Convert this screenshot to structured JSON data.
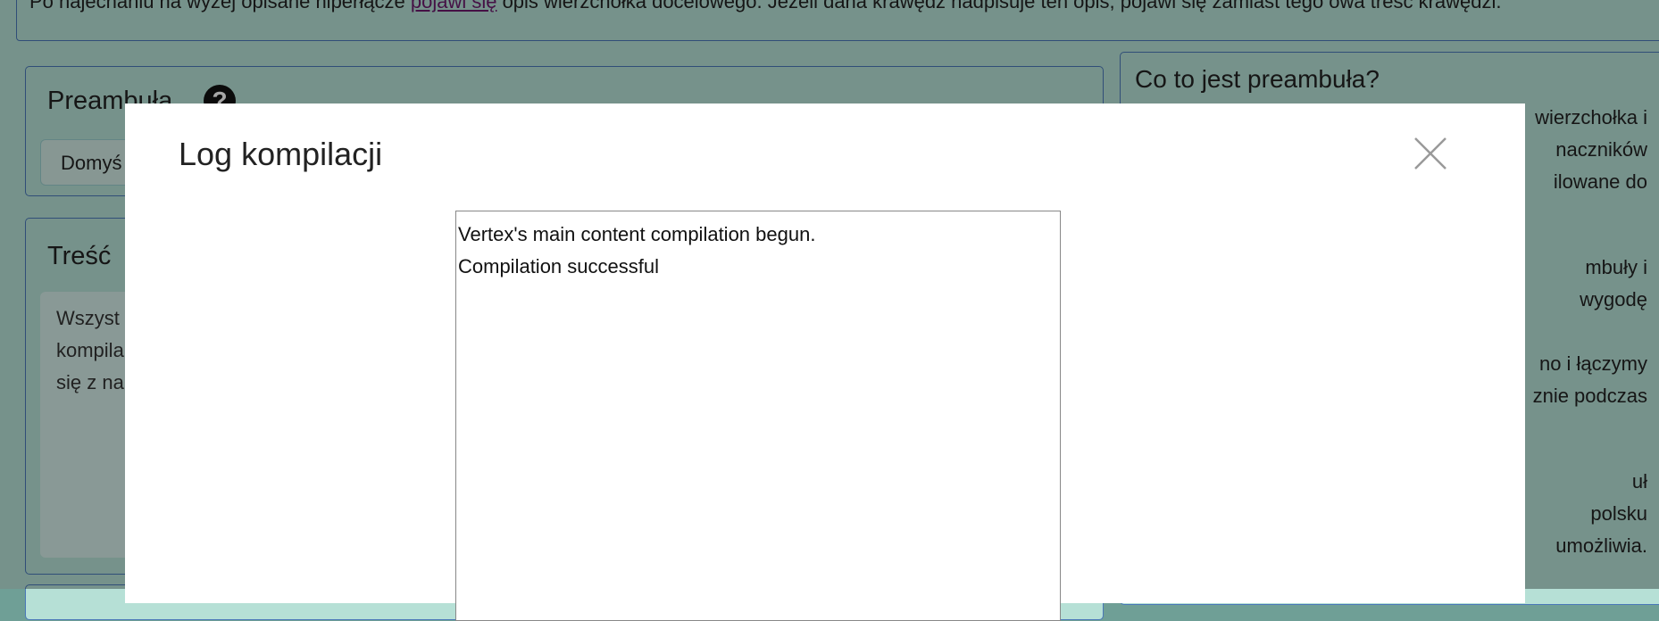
{
  "background": {
    "top_note": {
      "before": "Po najechaniu na wyżej opisane hiperłącze ",
      "link": "pojawi się",
      "after": " opis wierzchołka docelowego. Jeżeli dana krawędź nadpisuje ten opis, pojawi się zamiast tego owa treść krawędzi."
    },
    "preamble_panel": {
      "title": "Preambuła",
      "help_icon": "?",
      "button_label": "Domyś"
    },
    "content_panel": {
      "title": "Treść",
      "lines": [
        "Wszyst",
        "kompila",
        "się z na"
      ]
    },
    "side_panel": {
      "title": "Co to jest preambuła?",
      "lines": [
        "wierzchołka i",
        "naczników",
        "ilowane do",
        "mbuły i",
        "wygodę",
        "no i łączymy",
        "znie podczas",
        "uł",
        "polsku",
        "umożliwia."
      ]
    }
  },
  "modal": {
    "title": "Log kompilacji",
    "close_icon": "close-icon",
    "log_lines": [
      "Vertex's main content compilation begun.",
      "Compilation successful"
    ]
  }
}
